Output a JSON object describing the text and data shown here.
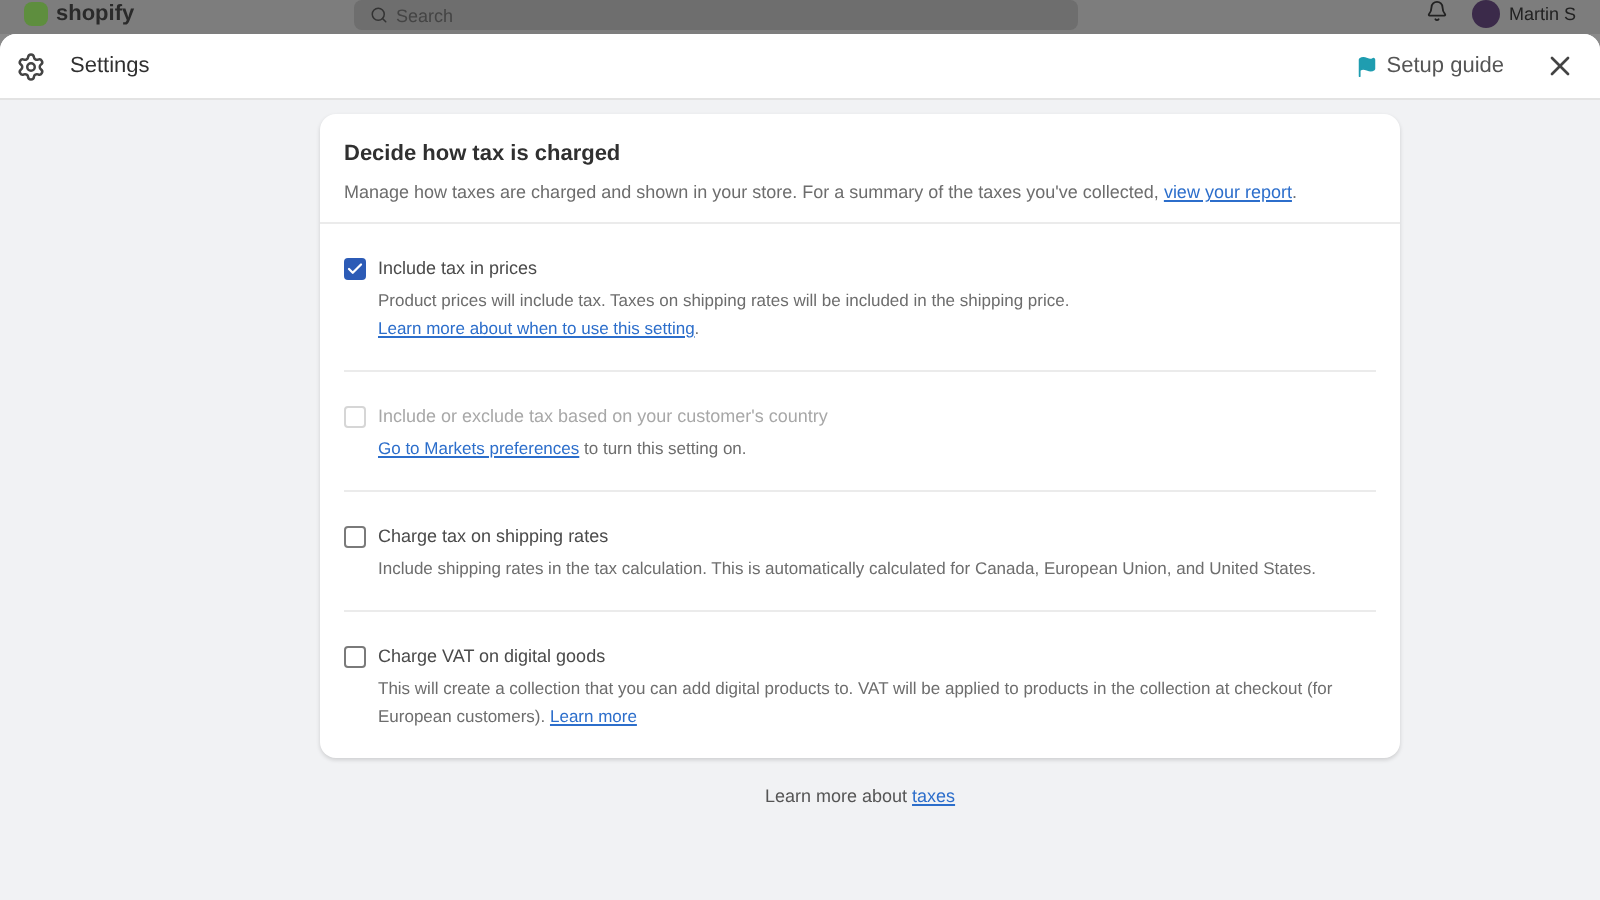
{
  "backdrop": {
    "logo": "shopify",
    "search": {
      "placeholder": "Search"
    },
    "user": "Martin S"
  },
  "header": {
    "title": "Settings",
    "guide": "Setup guide"
  },
  "card": {
    "title": "Decide how tax is charged",
    "description": {
      "text": "Manage how taxes are charged and shown in your store. For a summary of the taxes you've collected, ",
      "link": "view your report",
      "after": "."
    },
    "options": [
      {
        "label": "Include tax in prices",
        "checked": true,
        "disabled": false,
        "description": {
          "text": "Product prices will include tax. Taxes on shipping rates will be included in the shipping price. ",
          "link": "Learn more about when to use this setting",
          "after": "."
        }
      },
      {
        "label": "Include or exclude tax based on your customer's country",
        "checked": false,
        "disabled": true,
        "description": {
          "link": "Go to Markets preferences",
          "after": " to turn this setting on."
        }
      },
      {
        "label": "Charge tax on shipping rates",
        "checked": false,
        "disabled": false,
        "description": {
          "text": "Include shipping rates in the tax calculation. This is automatically calculated for Canada, European Union, and United States."
        }
      },
      {
        "label": "Charge VAT on digital goods",
        "checked": false,
        "disabled": false,
        "description": {
          "text": "This will create a collection that you can add digital products to. VAT will be applied to products in the collection at checkout (for European customers). ",
          "link": "Learn more"
        }
      }
    ]
  },
  "footer": {
    "text": "Learn more about ",
    "link": "taxes"
  }
}
